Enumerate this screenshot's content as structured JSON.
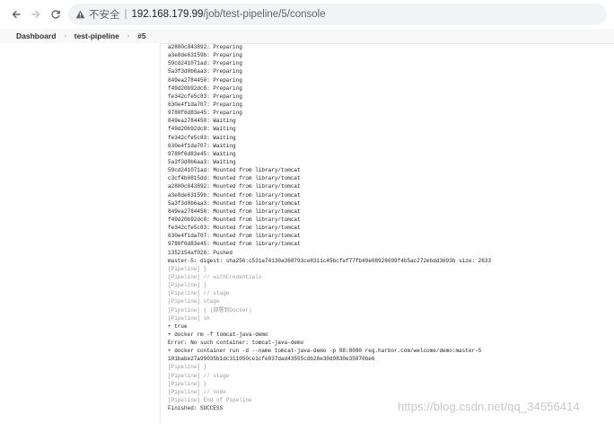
{
  "browser": {
    "insecure_label": "不安全",
    "url_host": "192.168.179.99",
    "url_path": "/job/test-pipeline/5/console"
  },
  "breadcrumb": {
    "items": [
      "Dashboard",
      "test-pipeline",
      "#5"
    ]
  },
  "console": {
    "lines": [
      {
        "text": "a2800c843892: Preparing",
        "dim": false
      },
      {
        "text": "a3e8de63159b: Preparing",
        "dim": false
      },
      {
        "text": "59cd241071ad: Preparing",
        "dim": false
      },
      {
        "text": "5a3f3d0b6aa3: Preparing",
        "dim": false
      },
      {
        "text": "849ea2784450: Preparing",
        "dim": false
      },
      {
        "text": "f49d20b92dc8: Preparing",
        "dim": false
      },
      {
        "text": "fe342cfe5c83: Preparing",
        "dim": false
      },
      {
        "text": "630e4f1da707: Preparing",
        "dim": false
      },
      {
        "text": "9780f6d83e45: Preparing",
        "dim": false
      },
      {
        "text": "849ea2784450: Waiting",
        "dim": false
      },
      {
        "text": "f49d20b92dc8: Waiting",
        "dim": false
      },
      {
        "text": "fe342cfe5c83: Waiting",
        "dim": false
      },
      {
        "text": "630e4f1da707: Waiting",
        "dim": false
      },
      {
        "text": "9780f6d83e45: Waiting",
        "dim": false
      },
      {
        "text": "5a3f3d0b6aa3: Waiting",
        "dim": false
      },
      {
        "text": "59cd241071ad: Mounted from library/tomcat",
        "dim": false
      },
      {
        "text": "c3cf4b0815dd: Mounted from library/tomcat",
        "dim": false
      },
      {
        "text": "a2800c843892: Mounted from library/tomcat",
        "dim": false
      },
      {
        "text": "a3e8de63159b: Mounted from library/tomcat",
        "dim": false
      },
      {
        "text": "5a3f3d0b6aa3: Mounted from library/tomcat",
        "dim": false
      },
      {
        "text": "849ea2784450: Mounted from library/tomcat",
        "dim": false
      },
      {
        "text": "f49d20b92dc8: Mounted from library/tomcat",
        "dim": false
      },
      {
        "text": "fe342cfe5c83: Mounted from library/tomcat",
        "dim": false
      },
      {
        "text": "630e4f1da707: Mounted from library/tomcat",
        "dim": false
      },
      {
        "text": "9780f6d83e45: Mounted from library/tomcat",
        "dim": false
      },
      {
        "text": "1352154af026: Pushed",
        "dim": false
      },
      {
        "text": "master-5: digest: sha256:c531a74130a368793ce8311c45bcfaf77fb49e08928699f4b5ac272ebdd3693b size: 2633",
        "dim": false
      },
      {
        "text": "[Pipeline] }",
        "dim": true
      },
      {
        "text": "[Pipeline] // withCredentials",
        "dim": true
      },
      {
        "text": "[Pipeline] }",
        "dim": true
      },
      {
        "text": "[Pipeline] // stage",
        "dim": true
      },
      {
        "text": "[Pipeline] stage",
        "dim": true
      },
      {
        "text": "[Pipeline] { (部署到Docker)",
        "dim": true
      },
      {
        "text": "[Pipeline] sh",
        "dim": true
      },
      {
        "text": "+ true",
        "dim": false
      },
      {
        "text": "+ docker rm -f tomcat-java-demo",
        "dim": false
      },
      {
        "text": "Error: No such container: tomcat-java-demo",
        "dim": false
      },
      {
        "text": "+ docker container run -d --name tomcat-java-demo -p 88:8080 reg.harbor.com/welcome/demo:master-5",
        "dim": false
      },
      {
        "text": "101babe27a99035b1dc311050ce1cfe837dad43555cdb26e30d9830e35870be6",
        "dim": false
      },
      {
        "text": "[Pipeline] }",
        "dim": true
      },
      {
        "text": "[Pipeline] // stage",
        "dim": true
      },
      {
        "text": "[Pipeline] }",
        "dim": true
      },
      {
        "text": "[Pipeline] // node",
        "dim": true
      },
      {
        "text": "[Pipeline] End of Pipeline",
        "dim": true
      },
      {
        "text": "Finished: SUCCESS",
        "dim": false
      }
    ]
  },
  "watermark": "https://blog.csdn.net/qq_34556414"
}
